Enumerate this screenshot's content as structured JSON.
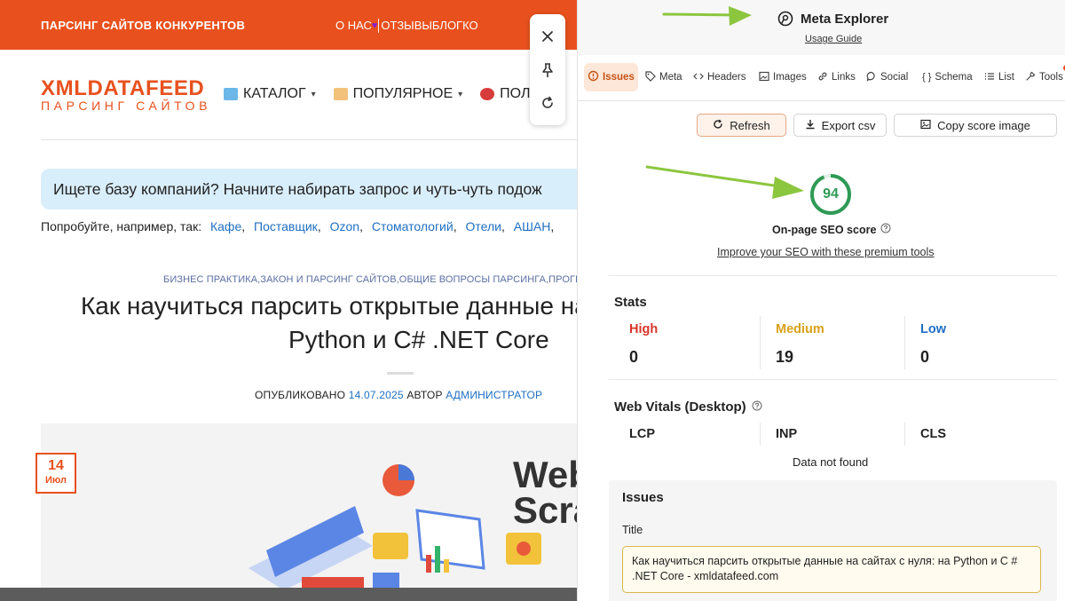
{
  "site": {
    "topbar": {
      "brand": "ПАРСИНГ САЙТОВ КОНКУРЕНТОВ",
      "nav": [
        "О НАС",
        "ОТЗЫВЫ",
        "БЛОГ",
        "КО"
      ]
    },
    "logo": {
      "line1": "XMLDATAFEED",
      "line2": "ПАРСИНГ САЙТОВ"
    },
    "main_nav": [
      "КАТАЛОГ",
      "ПОПУЛЯРНОЕ",
      "ПОЛЕЗ"
    ],
    "search": {
      "placeholder": "Ищете базу компаний? Начните набирать запрос и чуть-чуть подож"
    },
    "try": {
      "label": "Попробуйте, например, так:",
      "links": [
        "Кафе",
        "Поставщик",
        "Ozon",
        "Стоматологий",
        "Отели",
        "АШАН"
      ]
    },
    "article": {
      "categories": "БИЗНЕС ПРАКТИКА,ЗАКОН И ПАРСИНГ САЙТОВ,ОБЩИЕ ВОПРОСЫ ПАРСИНГА,ПРОГРАМ",
      "title_line1": "Как научиться парсить открытые данные на сай",
      "title_line2": "Python и C# .NET Core",
      "published_label": "ОПУБЛИКОВАНО",
      "date": "14.07.2025",
      "author_label": "АВТОР",
      "author": "АДМИНИСТРАТОР",
      "badge_day": "14",
      "badge_month": "Июл",
      "hero_text_line1": "Web",
      "hero_text_line2": "Scra"
    }
  },
  "panel": {
    "title": "Meta Explorer",
    "usage_guide": "Usage Guide",
    "tabs": [
      {
        "label": "Issues",
        "icon": "issues-icon",
        "active": true
      },
      {
        "label": "Meta",
        "icon": "tag-icon"
      },
      {
        "label": "Headers",
        "icon": "code-icon"
      },
      {
        "label": "Images",
        "icon": "image-icon"
      },
      {
        "label": "Links",
        "icon": "link-icon"
      },
      {
        "label": "Social",
        "icon": "chat-icon"
      },
      {
        "label": "Schema",
        "icon": "braces-icon"
      },
      {
        "label": "List",
        "icon": "list-icon"
      },
      {
        "label": "Tools",
        "icon": "wrench-icon"
      }
    ],
    "buttons": {
      "refresh": "Refresh",
      "export": "Export csv",
      "copy": "Copy score image"
    },
    "score": {
      "value": "94",
      "label": "On-page SEO score",
      "improve_link": "Improve your SEO with these premium tools"
    },
    "stats": {
      "title": "Stats",
      "high": {
        "label": "High",
        "value": "0"
      },
      "medium": {
        "label": "Medium",
        "value": "19"
      },
      "low": {
        "label": "Low",
        "value": "0"
      }
    },
    "vitals": {
      "title": "Web Vitals (Desktop)",
      "lcp": "LCP",
      "inp": "INP",
      "cls": "CLS",
      "not_found": "Data not found"
    },
    "issues": {
      "title": "Issues",
      "field_label": "Title",
      "title_value": "Как научиться парсить открытые данные на сайтах с нуля: на Python и C # .NET Core - xmldatafeed.com"
    }
  },
  "colors": {
    "brand_orange": "#e8511e",
    "score_green": "#2f9a55",
    "high": "#d9342b",
    "medium": "#d9a11a",
    "low": "#1f6fc2",
    "arrow_green": "#8cc63f"
  }
}
